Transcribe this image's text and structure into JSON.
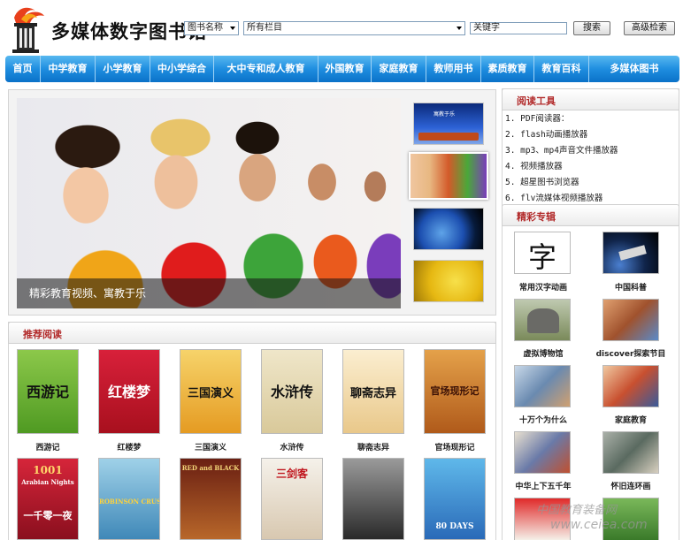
{
  "header": {
    "site_title": "多媒体数字图书馆",
    "search_type": "图书名称",
    "category": "所有栏目",
    "keyword_value": "关键字",
    "search_label": "搜索",
    "advanced_label": "高级检索"
  },
  "nav": {
    "items": [
      "首页",
      "中学教育",
      "小学教育",
      "中小学综合",
      "大中专和成人教育",
      "外国教育",
      "家庭教育",
      "教师用书",
      "素质教育",
      "教育百科",
      "多媒体图书"
    ]
  },
  "hero": {
    "caption": "精彩教育视频、寓教于乐",
    "thumb_text": "寓教于乐"
  },
  "recommended": {
    "title": "推荐阅读",
    "books": [
      {
        "title": "西游记",
        "cover": "西游记"
      },
      {
        "title": "红楼梦",
        "cover": "红楼梦"
      },
      {
        "title": "三国演义",
        "cover": "三国演义"
      },
      {
        "title": "水浒传",
        "cover": "水浒传"
      },
      {
        "title": "聊斋志异",
        "cover": "聊斋志异"
      },
      {
        "title": "官场现形记",
        "cover": "官场现形记"
      }
    ],
    "row2_covers": [
      "1001",
      "Arabian Nights",
      "一千零一夜",
      "ROBINSON CRUSOE",
      "RED and BLACK",
      "三剑客",
      "80 DAYS"
    ]
  },
  "tools": {
    "title": "阅读工具",
    "items": [
      "PDF阅读器：",
      "flash动画播放器",
      "mp3、mp4声音文件播放器",
      "视频播放器",
      "超星图书浏览器",
      "flv流媒体视频播放器"
    ]
  },
  "features": {
    "title": "精彩专辑",
    "items": [
      {
        "label": "常用汉字动画",
        "image_text": "字"
      },
      {
        "label": "中国科普"
      },
      {
        "label": "虚拟博物馆"
      },
      {
        "label": "discover探索节目"
      },
      {
        "label": "十万个为什么"
      },
      {
        "label": "家庭教育"
      },
      {
        "label": "中华上下五千年"
      },
      {
        "label": "怀旧连环画"
      }
    ]
  },
  "watermark": {
    "line1": "中国教育装备网",
    "line2": "www.ceiea.com"
  },
  "colors": {
    "nav_blue": "#1f8ee0",
    "section_title_red": "#b22a2a"
  }
}
